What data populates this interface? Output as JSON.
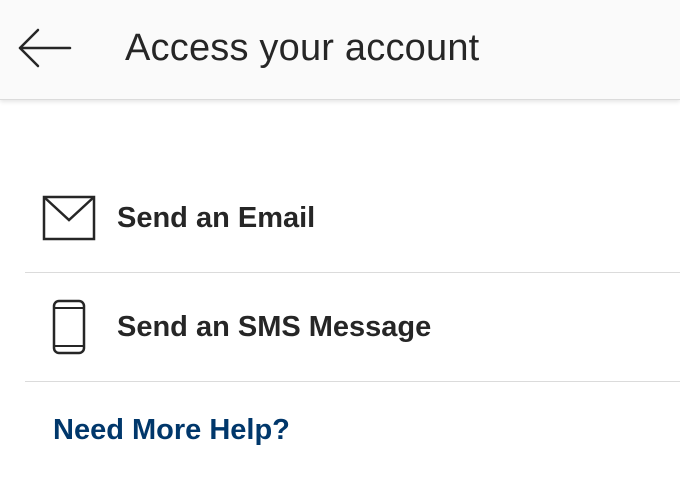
{
  "header": {
    "back_icon": "arrow-left-icon",
    "title": "Access your account"
  },
  "options": [
    {
      "icon": "envelope-icon",
      "label": "Send an Email"
    },
    {
      "icon": "phone-icon",
      "label": "Send an SMS Message"
    }
  ],
  "help": {
    "label": "Need More Help?"
  },
  "colors": {
    "text": "#262626",
    "link": "#00376b",
    "header_bg": "#fafafa",
    "divider": "#dbdbdb"
  }
}
